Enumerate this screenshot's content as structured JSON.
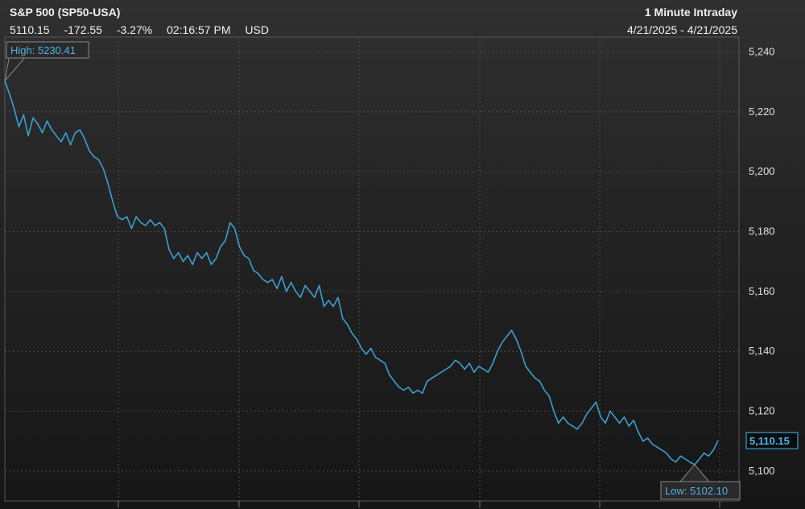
{
  "header": {
    "title": "S&P 500 (SP50-USA)",
    "last": "5110.15",
    "change": "-172.55",
    "change_pct": "-3.27%",
    "time": "02:16:57 PM",
    "currency": "USD",
    "interval": "1 Minute Intraday",
    "date_range": "4/21/2025 - 4/21/2025"
  },
  "colors": {
    "line": "#3a9fd0",
    "label_text": "#4fb3e6",
    "grid": "#4a4a4a"
  },
  "chart_data": {
    "type": "line",
    "title": "S&P 500 (SP50-USA)",
    "xlabel": "",
    "ylabel": "",
    "ylim": [
      5090,
      5245
    ],
    "yticks": [
      5100,
      5120,
      5140,
      5160,
      5180,
      5200,
      5220,
      5240
    ],
    "ytick_labels": [
      "5,100",
      "5,120",
      "5,140",
      "5,160",
      "5,180",
      "5,200",
      "5,220",
      "5,240"
    ],
    "grid": true,
    "legend": "none",
    "high_label": "High: 5230.41",
    "low_label": "Low: 5102.10",
    "last_label": "5,110.15",
    "series": [
      {
        "values": [
          5230.4,
          5226,
          5221,
          5215,
          5219,
          5212,
          5218,
          5216,
          5213,
          5217,
          5214,
          5212,
          5210,
          5213,
          5209,
          5213,
          5214,
          5211,
          5207,
          5205,
          5204,
          5201,
          5196,
          5190,
          5185,
          5184,
          5185,
          5181,
          5185,
          5183,
          5182,
          5184,
          5182,
          5183,
          5181,
          5174,
          5171,
          5173,
          5170,
          5172,
          5169,
          5173,
          5171,
          5173,
          5169,
          5171,
          5175,
          5177,
          5183,
          5181,
          5175,
          5172,
          5171,
          5167,
          5166,
          5164,
          5163,
          5164,
          5161,
          5165,
          5160,
          5163,
          5160,
          5158,
          5162,
          5160,
          5158,
          5162,
          5155,
          5157,
          5155,
          5158,
          5151,
          5149,
          5146,
          5144,
          5141,
          5139,
          5141,
          5138,
          5137,
          5136,
          5132,
          5130,
          5128,
          5127,
          5128,
          5126,
          5127,
          5126,
          5130,
          5131,
          5132,
          5133,
          5134,
          5135,
          5137,
          5136,
          5134,
          5136,
          5133,
          5135,
          5134,
          5133,
          5136,
          5140,
          5143,
          5145,
          5147,
          5144,
          5140,
          5135,
          5133,
          5131,
          5130,
          5127,
          5125,
          5120,
          5116,
          5118,
          5116,
          5115,
          5114,
          5116,
          5119,
          5121,
          5123,
          5118,
          5116,
          5120,
          5118,
          5116,
          5118,
          5115,
          5117,
          5113,
          5110,
          5111,
          5109,
          5108,
          5107,
          5106,
          5104,
          5103,
          5105,
          5104,
          5103,
          5102.1,
          5104,
          5106,
          5105,
          5107,
          5110.15
        ]
      }
    ]
  }
}
